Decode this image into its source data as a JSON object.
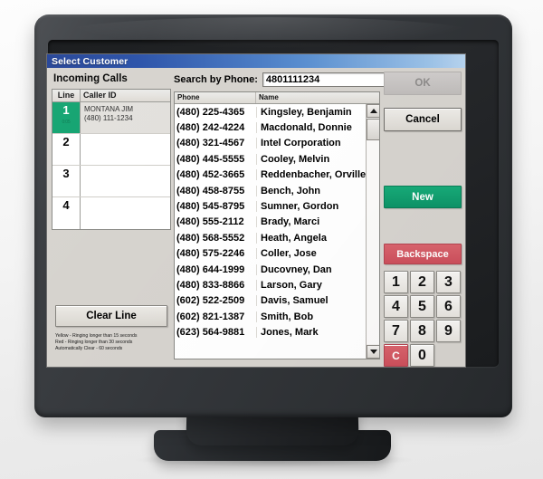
{
  "window": {
    "title": "Select Customer"
  },
  "left_panel": {
    "heading": "Incoming Calls",
    "columns": [
      "Line",
      "Caller ID"
    ],
    "rows": [
      {
        "line": "1",
        "timer": "0:05",
        "caller_name": "MONTANA JIM",
        "caller_number": "(480) 111-1234",
        "active": true
      },
      {
        "line": "2",
        "timer": "",
        "caller_name": "",
        "caller_number": "",
        "active": false
      },
      {
        "line": "3",
        "timer": "",
        "caller_name": "",
        "caller_number": "",
        "active": false
      },
      {
        "line": "4",
        "timer": "",
        "caller_name": "",
        "caller_number": "",
        "active": false
      }
    ],
    "clear_line_label": "Clear Line",
    "legend": [
      "Yellow - Ringing longer than 15 seconds",
      "Red - Ringing longer than 30 seconds",
      "Automatically Clear - 60 seconds"
    ]
  },
  "search": {
    "label": "Search by Phone:",
    "value": "4801111234",
    "placeholder": ""
  },
  "results": {
    "columns": [
      "Phone",
      "Name"
    ],
    "rows": [
      {
        "phone": "(480) 225-4365",
        "name": "Kingsley, Benjamin"
      },
      {
        "phone": "(480) 242-4224",
        "name": "Macdonald, Donnie"
      },
      {
        "phone": "(480) 321-4567",
        "name": "Intel Corporation"
      },
      {
        "phone": "(480) 445-5555",
        "name": "Cooley, Melvin"
      },
      {
        "phone": "(480) 452-3665",
        "name": "Reddenbacher, Orville"
      },
      {
        "phone": "(480) 458-8755",
        "name": "Bench, John"
      },
      {
        "phone": "(480) 545-8795",
        "name": "Sumner, Gordon"
      },
      {
        "phone": "(480) 555-2112",
        "name": "Brady, Marci"
      },
      {
        "phone": "(480) 568-5552",
        "name": "Heath, Angela"
      },
      {
        "phone": "(480) 575-2246",
        "name": "Coller, Jose"
      },
      {
        "phone": "(480) 644-1999",
        "name": "Ducovney, Dan"
      },
      {
        "phone": "(480) 833-8866",
        "name": "Larson, Gary"
      },
      {
        "phone": "(602) 522-2509",
        "name": "Davis, Samuel"
      },
      {
        "phone": "(602) 821-1387",
        "name": "Smith, Bob"
      },
      {
        "phone": "(623) 564-9881",
        "name": "Jones, Mark"
      }
    ]
  },
  "actions": {
    "ok_label": "OK",
    "cancel_label": "Cancel",
    "new_label": "New",
    "backspace_label": "Backspace"
  },
  "keypad": {
    "keys": [
      "1",
      "2",
      "3",
      "4",
      "5",
      "6",
      "7",
      "8",
      "9",
      "C",
      "0",
      ""
    ]
  },
  "colors": {
    "titlebar_start": "#1f3f94",
    "titlebar_end": "#b7d4ef",
    "active_line_green": "#0fa26e",
    "new_button_green": "#0d9367",
    "backspace_red": "#cc4f5b",
    "dialog_face": "#d6d3ce"
  }
}
